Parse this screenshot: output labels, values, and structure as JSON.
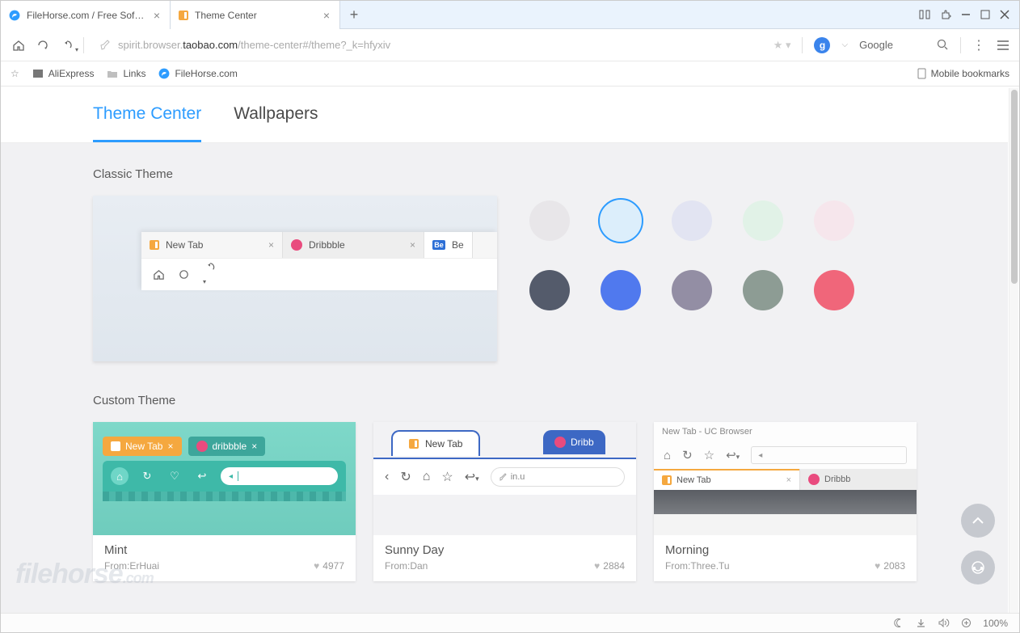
{
  "titlebar": {
    "tab1": "FileHorse.com / Free Software",
    "tab2": "Theme Center"
  },
  "addr": {
    "url_prefix": "spirit.browser.",
    "url_host": "taobao.com",
    "url_path": "/theme-center#/theme?_k=hfyxiv",
    "search_engine": "Google"
  },
  "bookmarks": {
    "b1": "AliExpress",
    "b2": "Links",
    "b3": "FileHorse.com",
    "mobile": "Mobile bookmarks"
  },
  "nav": {
    "tab1": "Theme Center",
    "tab2": "Wallpapers"
  },
  "sections": {
    "classic": "Classic Theme",
    "custom": "Custom Theme"
  },
  "preview": {
    "tab1": "New Tab",
    "tab2": "Dribbble",
    "tab3": "Be"
  },
  "swatches": [
    "#e8e6e9",
    "#dceefb",
    "#e2e4f2",
    "#e1f2e7",
    "#f6e6ec",
    "#545b6b",
    "#5079ee",
    "#938ea4",
    "#8d9c94",
    "#f0667a"
  ],
  "themes": [
    {
      "name": "Mint",
      "from_label": "From:",
      "author": "ErHuai",
      "likes": "4977",
      "tab1": "New Tab",
      "tab2": "dribbble"
    },
    {
      "name": "Sunny Day",
      "from_label": "From:",
      "author": "Dan",
      "likes": "2884",
      "tab1": "New Tab",
      "tab2": "Dribb",
      "url": "in.u"
    },
    {
      "name": "Morning",
      "from_label": "From:",
      "author": "Three.Tu",
      "likes": "2083",
      "title": "New Tab - UC Browser",
      "tab1": "New Tab",
      "tab2": "Dribbb"
    }
  ],
  "status": {
    "zoom": "100%"
  },
  "watermark": {
    "t1": "filehorse",
    "t2": ".com"
  }
}
